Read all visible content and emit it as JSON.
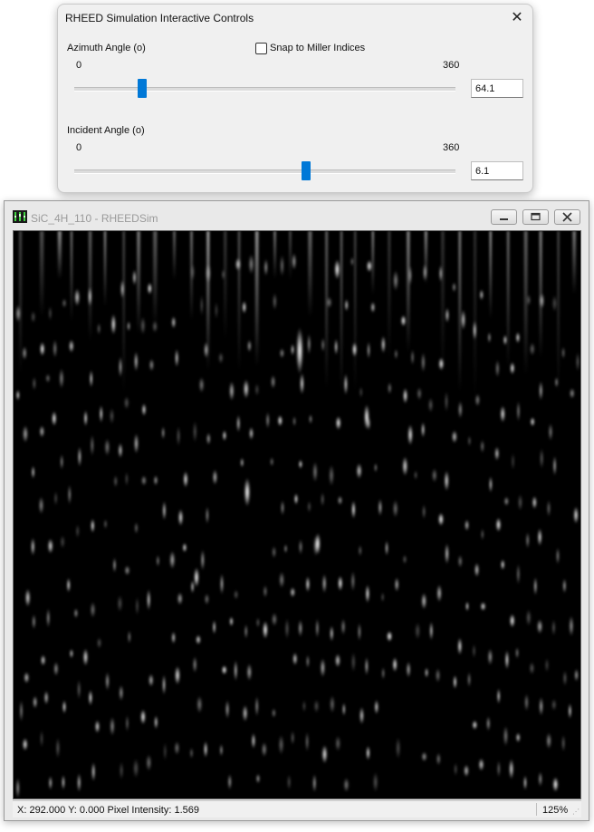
{
  "controls": {
    "title": "RHEED Simulation Interactive Controls",
    "close_glyph": "✕",
    "azimuth": {
      "label": "Azimuth Angle (o)",
      "min_label": "0",
      "max_label": "360",
      "value": "64.1",
      "slider_fraction": 0.178
    },
    "snap": {
      "label": "Snap to Miller Indices",
      "checked": false
    },
    "incident": {
      "label": "Incident Angle (o)",
      "min_label": "0",
      "max_label": "360",
      "value": "6.1",
      "slider_fraction": 0.607
    }
  },
  "image_window": {
    "title": "SiC_4H_110 - RHEEDSim",
    "app_icon": "rheed-pattern-icon",
    "buttons": {
      "minimize_glyph": "▭",
      "maximize_glyph": "▣",
      "close_glyph": "✕"
    },
    "status": {
      "readout": "X: 292.000 Y: 0.000 Pixel Intensity: 1.569",
      "zoom": "125%"
    }
  },
  "colors": {
    "accent": "#0078d7",
    "background": "#000000",
    "spot": "#ffffff"
  }
}
